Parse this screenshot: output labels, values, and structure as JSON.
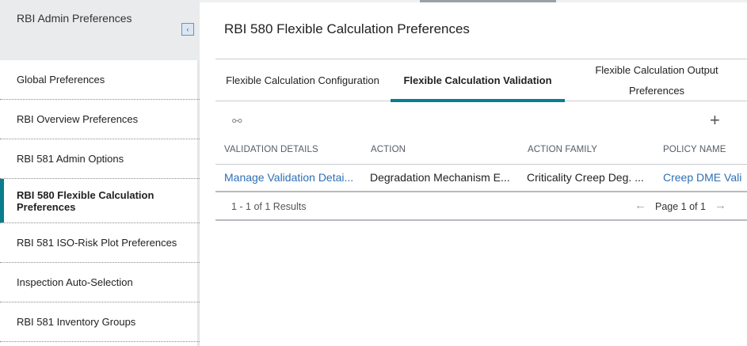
{
  "sidebar": {
    "title": "RBI Admin Preferences",
    "collapse_glyph": "‹",
    "items": [
      {
        "label": "Global Preferences"
      },
      {
        "label": "RBI Overview Preferences"
      },
      {
        "label": "RBI 581 Admin Options"
      },
      {
        "label": "RBI 580 Flexible Calculation Preferences",
        "active": true
      },
      {
        "label": "RBI 581 ISO-Risk Plot Preferences"
      },
      {
        "label": "Inspection Auto-Selection"
      },
      {
        "label": "RBI 581 Inventory Groups"
      }
    ]
  },
  "main": {
    "title": "RBI 580 Flexible Calculation Preferences",
    "tabs": [
      {
        "label": "Flexible Calculation Configuration"
      },
      {
        "label": "Flexible Calculation Validation",
        "active": true
      },
      {
        "label": "Flexible Calculation Output Preferences"
      }
    ],
    "toolbar": {
      "binoculars_glyph": "⚯",
      "add_glyph": "+"
    },
    "table": {
      "columns": [
        "VALIDATION DETAILS",
        "ACTION",
        "ACTION FAMILY",
        "POLICY NAME"
      ],
      "rows": [
        [
          "Manage Validation Detai...",
          "Degradation Mechanism E...",
          "Criticality Creep Deg. ...",
          "Creep DME Vali"
        ]
      ]
    },
    "footer": {
      "results": "1 - 1 of 1 Results",
      "page_label": "Page 1 of 1",
      "prev_glyph": "←",
      "next_glyph": "→"
    }
  },
  "colors": {
    "accent": "#0a7d8e",
    "link": "#2f6fb3",
    "sidebar_header_bg": "#e9ebed"
  }
}
